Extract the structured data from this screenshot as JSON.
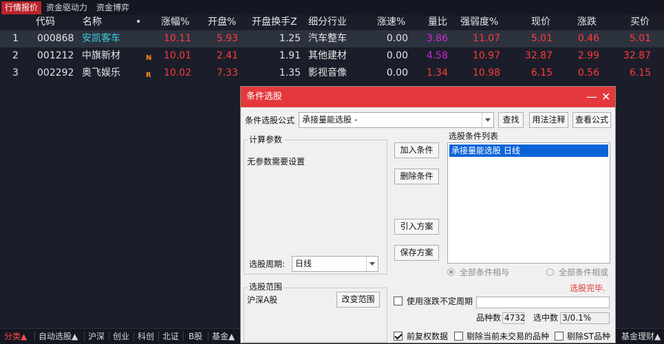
{
  "top_tabs": [
    "行情报价",
    "资金驱动力",
    "资金博弈"
  ],
  "columns": [
    "代码",
    "名称",
    "•",
    "涨幅%",
    "开盘%",
    "开盘换手Z",
    "细分行业",
    "涨速%",
    "量比",
    "强弱度%",
    "现价",
    "涨跌",
    "买价"
  ],
  "rows": [
    {
      "idx": "1",
      "code": "000868",
      "name": "安凯客车",
      "badge": "",
      "chg": "10.11",
      "open": "5.93",
      "turnover": "1.25",
      "industry": "汽车整车",
      "speed": "0.00",
      "vol_ratio": "3.86",
      "strength": "11.07",
      "price": "5.01",
      "diff": "0.46",
      "bid": "5.01"
    },
    {
      "idx": "2",
      "code": "001212",
      "name": "中旗新材",
      "badge": "N",
      "chg": "10.01",
      "open": "2.41",
      "turnover": "1.91",
      "industry": "其他建材",
      "speed": "0.00",
      "vol_ratio": "4.58",
      "strength": "10.97",
      "price": "32.87",
      "diff": "2.99",
      "bid": "32.87"
    },
    {
      "idx": "3",
      "code": "002292",
      "name": "奥飞娱乐",
      "badge": "R",
      "chg": "10.02",
      "open": "7.33",
      "turnover": "1.35",
      "industry": "影视音像",
      "speed": "0.00",
      "vol_ratio": "1.34",
      "strength": "10.98",
      "price": "6.15",
      "diff": "0.56",
      "bid": "6.15"
    }
  ],
  "bottom_tabs": [
    "分类▲",
    "自动选股▲",
    "沪深",
    "创业",
    "科创",
    "北证",
    "B股",
    "基金▲",
    "基金理财▲"
  ],
  "dialog": {
    "title": "条件选股",
    "formula_label": "条件选股公式",
    "formula_value": "承接量能选股 -",
    "btn_find": "查找",
    "btn_usage": "用法注释",
    "btn_view": "查看公式",
    "params_title": "计算参数",
    "params_text": "无参数需要设置",
    "period_label": "选股周期:",
    "period_value": "日线",
    "btn_add": "加入条件",
    "btn_delete": "删除条件",
    "btn_import": "引入方案",
    "btn_save": "保存方案",
    "list_title": "选股条件列表",
    "list_items": [
      "承接量能选股  日线"
    ],
    "radio_and": "全部条件相与",
    "radio_or": "全部条件相或",
    "status": "选股完毕.",
    "range_title": "选股范围",
    "range_value": "沪深A股",
    "btn_change_range": "改变范围",
    "use_uncertain_label": "使用涨跌不定周期",
    "count_label": "品种数",
    "count_value": "4732",
    "selected_label": "选中数",
    "selected_value": "3/0.1%",
    "chk_fq": "前复权数据",
    "chk_exclude_notrade": "剔除当前未交易的品种",
    "chk_exclude_st": "剔除ST品种"
  },
  "colors": {
    "accent": "#e4393c",
    "up": "#ff3b3b",
    "purple": "#cc2bd4",
    "cyan": "#39d0dd"
  }
}
